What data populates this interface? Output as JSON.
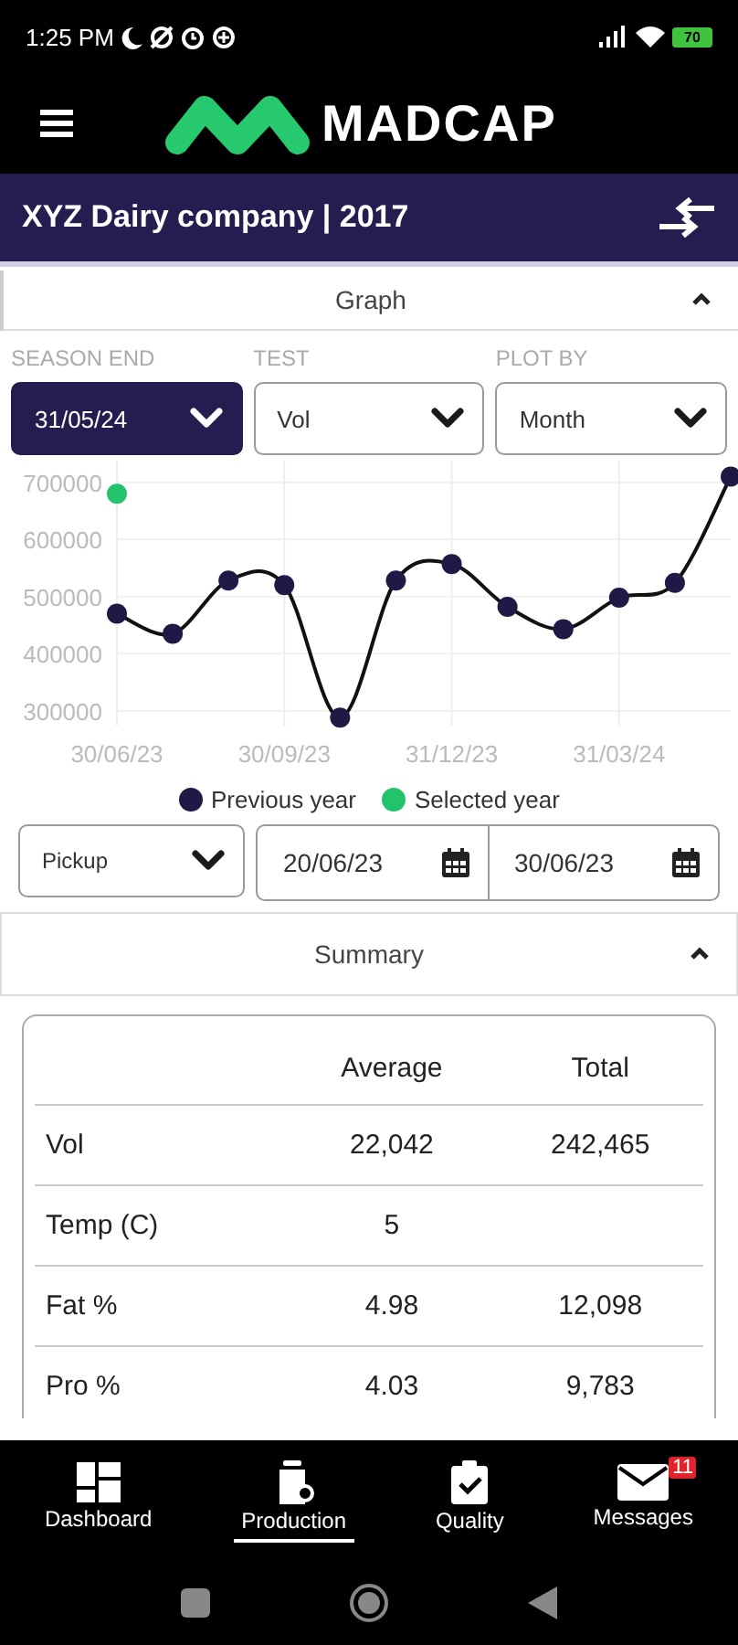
{
  "status_bar": {
    "time": "1:25 PM",
    "battery": "70"
  },
  "header": {
    "brand": "MADCAP"
  },
  "company_bar": {
    "title": "XYZ Dairy company | 2017"
  },
  "graph_section": {
    "title": "Graph",
    "expanded": true,
    "filters": [
      {
        "label": "SEASON END",
        "value": "31/05/24",
        "focused": true
      },
      {
        "label": "TEST",
        "value": "Vol",
        "focused": false
      },
      {
        "label": "PLOT BY",
        "value": "Month",
        "focused": false
      }
    ],
    "chart_data": {
      "type": "line",
      "categories": [
        "30/06/23",
        null,
        null,
        "30/09/23",
        null,
        null,
        "31/12/23",
        null,
        null,
        "31/03/24",
        null,
        null
      ],
      "grid": true,
      "series": [
        {
          "name": "Previous year",
          "color": "#1f1a45",
          "marker": "circle",
          "values": [
            470000,
            435000,
            528000,
            520000,
            288000,
            528000,
            557000,
            482000,
            443000,
            498000,
            524000,
            710000
          ]
        },
        {
          "name": "Selected year",
          "color": "#22c36b",
          "marker": "circle",
          "values": [
            680000,
            null,
            null,
            null,
            null,
            null,
            null,
            null,
            null,
            null,
            null,
            null
          ]
        }
      ],
      "ylim": [
        274000,
        738000
      ],
      "yticks": [
        300000,
        400000,
        500000,
        600000,
        700000
      ]
    },
    "range": {
      "type": "Pickup",
      "from": "20/06/23",
      "to": "30/06/23"
    }
  },
  "summary_section": {
    "title": "Summary",
    "expanded": true,
    "columns": [
      "Average",
      "Total"
    ],
    "rows": [
      {
        "label": "Vol",
        "average": "22,042",
        "total": "242,465"
      },
      {
        "label": "Temp (C)",
        "average": "5"
      },
      {
        "label": "Fat %",
        "average": "4.98",
        "total": "12,098"
      },
      {
        "label": "Pro %",
        "average": "4.03",
        "total": "9,783"
      }
    ]
  },
  "bottom_nav": [
    {
      "label": "Dashboard",
      "kind": "dashboard",
      "selected": false
    },
    {
      "label": "Production",
      "kind": "production",
      "selected": true
    },
    {
      "label": "Quality",
      "kind": "quality",
      "selected": false
    },
    {
      "label": "Messages",
      "kind": "messages",
      "selected": false,
      "badge": "11"
    }
  ]
}
